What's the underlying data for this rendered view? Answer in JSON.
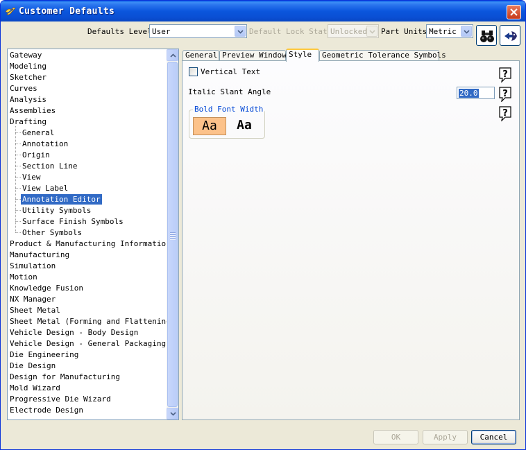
{
  "window": {
    "title": "Customer Defaults"
  },
  "toolbar": {
    "defaults_level_label": "Defaults Level",
    "defaults_level_value": "User",
    "lock_state_label": "Default Lock State",
    "lock_state_value": "Unlocked",
    "part_units_label": "Part Units",
    "part_units_value": "Metric",
    "find_icon": "binoculars-icon",
    "manage_icon": "bird-arrow-icon"
  },
  "tree": {
    "items": [
      {
        "label": "Gateway",
        "level": 0
      },
      {
        "label": "Modeling",
        "level": 0
      },
      {
        "label": "Sketcher",
        "level": 0
      },
      {
        "label": "Curves",
        "level": 0
      },
      {
        "label": "Analysis",
        "level": 0
      },
      {
        "label": "Assemblies",
        "level": 0
      },
      {
        "label": "Drafting",
        "level": 0
      },
      {
        "label": "General",
        "level": 1
      },
      {
        "label": "Annotation",
        "level": 1
      },
      {
        "label": "Origin",
        "level": 1
      },
      {
        "label": "Section Line",
        "level": 1
      },
      {
        "label": "View",
        "level": 1
      },
      {
        "label": "View Label",
        "level": 1
      },
      {
        "label": "Annotation Editor",
        "level": 1,
        "selected": true
      },
      {
        "label": "Utility Symbols",
        "level": 1
      },
      {
        "label": "Surface Finish Symbols",
        "level": 1
      },
      {
        "label": "Other Symbols",
        "level": 1
      },
      {
        "label": "Product & Manufacturing Information",
        "level": 0
      },
      {
        "label": "Manufacturing",
        "level": 0
      },
      {
        "label": "Simulation",
        "level": 0
      },
      {
        "label": "Motion",
        "level": 0
      },
      {
        "label": "Knowledge Fusion",
        "level": 0
      },
      {
        "label": "NX Manager",
        "level": 0
      },
      {
        "label": "Sheet Metal",
        "level": 0
      },
      {
        "label": "Sheet Metal (Forming and Flattening)",
        "level": 0
      },
      {
        "label": "Vehicle Design - Body Design",
        "level": 0
      },
      {
        "label": "Vehicle Design - General Packaging",
        "level": 0
      },
      {
        "label": "Die Engineering",
        "level": 0
      },
      {
        "label": "Die Design",
        "level": 0
      },
      {
        "label": "Design for Manufacturing",
        "level": 0
      },
      {
        "label": "Mold Wizard",
        "level": 0
      },
      {
        "label": "Progressive Die Wizard",
        "level": 0
      },
      {
        "label": "Electrode Design",
        "level": 0
      }
    ]
  },
  "tabs": [
    {
      "label": "General",
      "active": false
    },
    {
      "label": "Preview Window",
      "active": false
    },
    {
      "label": "Style",
      "active": true
    },
    {
      "label": "Geometric Tolerance Symbols",
      "active": false
    }
  ],
  "style_tab": {
    "vertical_text_label": "Vertical Text",
    "vertical_text_checked": false,
    "italic_slant_label": "Italic Slant Angle",
    "italic_slant_value": "20.0",
    "bold_font_group_label": "Bold Font Width",
    "bold_options": [
      "Aa",
      "Aa"
    ],
    "help_icon": "question-help-icon"
  },
  "buttons": {
    "ok": "OK",
    "apply": "Apply",
    "cancel": "Cancel"
  },
  "colors": {
    "selection": "#316ac5",
    "title_bar": "#0a5fe8",
    "pressed_button": "#fcc28a",
    "tab_highlight": "#ffc83c"
  }
}
